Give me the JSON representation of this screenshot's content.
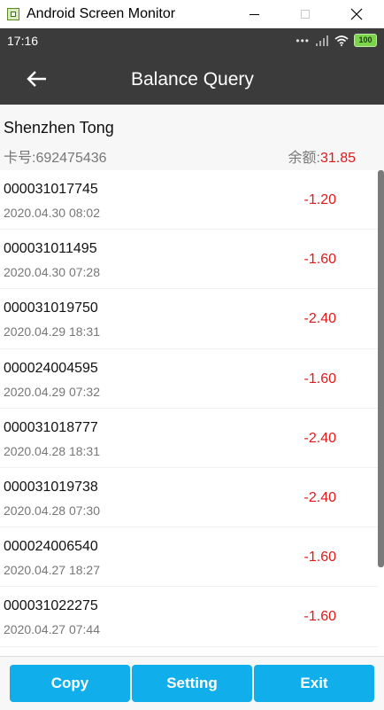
{
  "window": {
    "title": "Android Screen Monitor"
  },
  "status_bar": {
    "time": "17:16",
    "battery": "100"
  },
  "header": {
    "title": "Balance Query"
  },
  "card": {
    "name": "Shenzhen Tong",
    "number_label": "卡号:692475436",
    "balance_label": "余额:",
    "balance_value": "31.85"
  },
  "transactions": [
    {
      "id": "000031017745",
      "time": "2020.04.30 08:02",
      "amount": "-1.20"
    },
    {
      "id": "000031011495",
      "time": "2020.04.30 07:28",
      "amount": "-1.60"
    },
    {
      "id": "000031019750",
      "time": "2020.04.29 18:31",
      "amount": "-2.40"
    },
    {
      "id": "000024004595",
      "time": "2020.04.29 07:32",
      "amount": "-1.60"
    },
    {
      "id": "000031018777",
      "time": "2020.04.28 18:31",
      "amount": "-2.40"
    },
    {
      "id": "000031019738",
      "time": "2020.04.28 07:30",
      "amount": "-2.40"
    },
    {
      "id": "000024006540",
      "time": "2020.04.27 18:27",
      "amount": "-1.60"
    },
    {
      "id": "000031022275",
      "time": "2020.04.27 07:44",
      "amount": "-1.60"
    }
  ],
  "buttons": {
    "copy": "Copy",
    "setting": "Setting",
    "exit": "Exit"
  },
  "colors": {
    "accent": "#10aeea",
    "negative": "#e01818",
    "appbar": "#3b3b3b"
  }
}
